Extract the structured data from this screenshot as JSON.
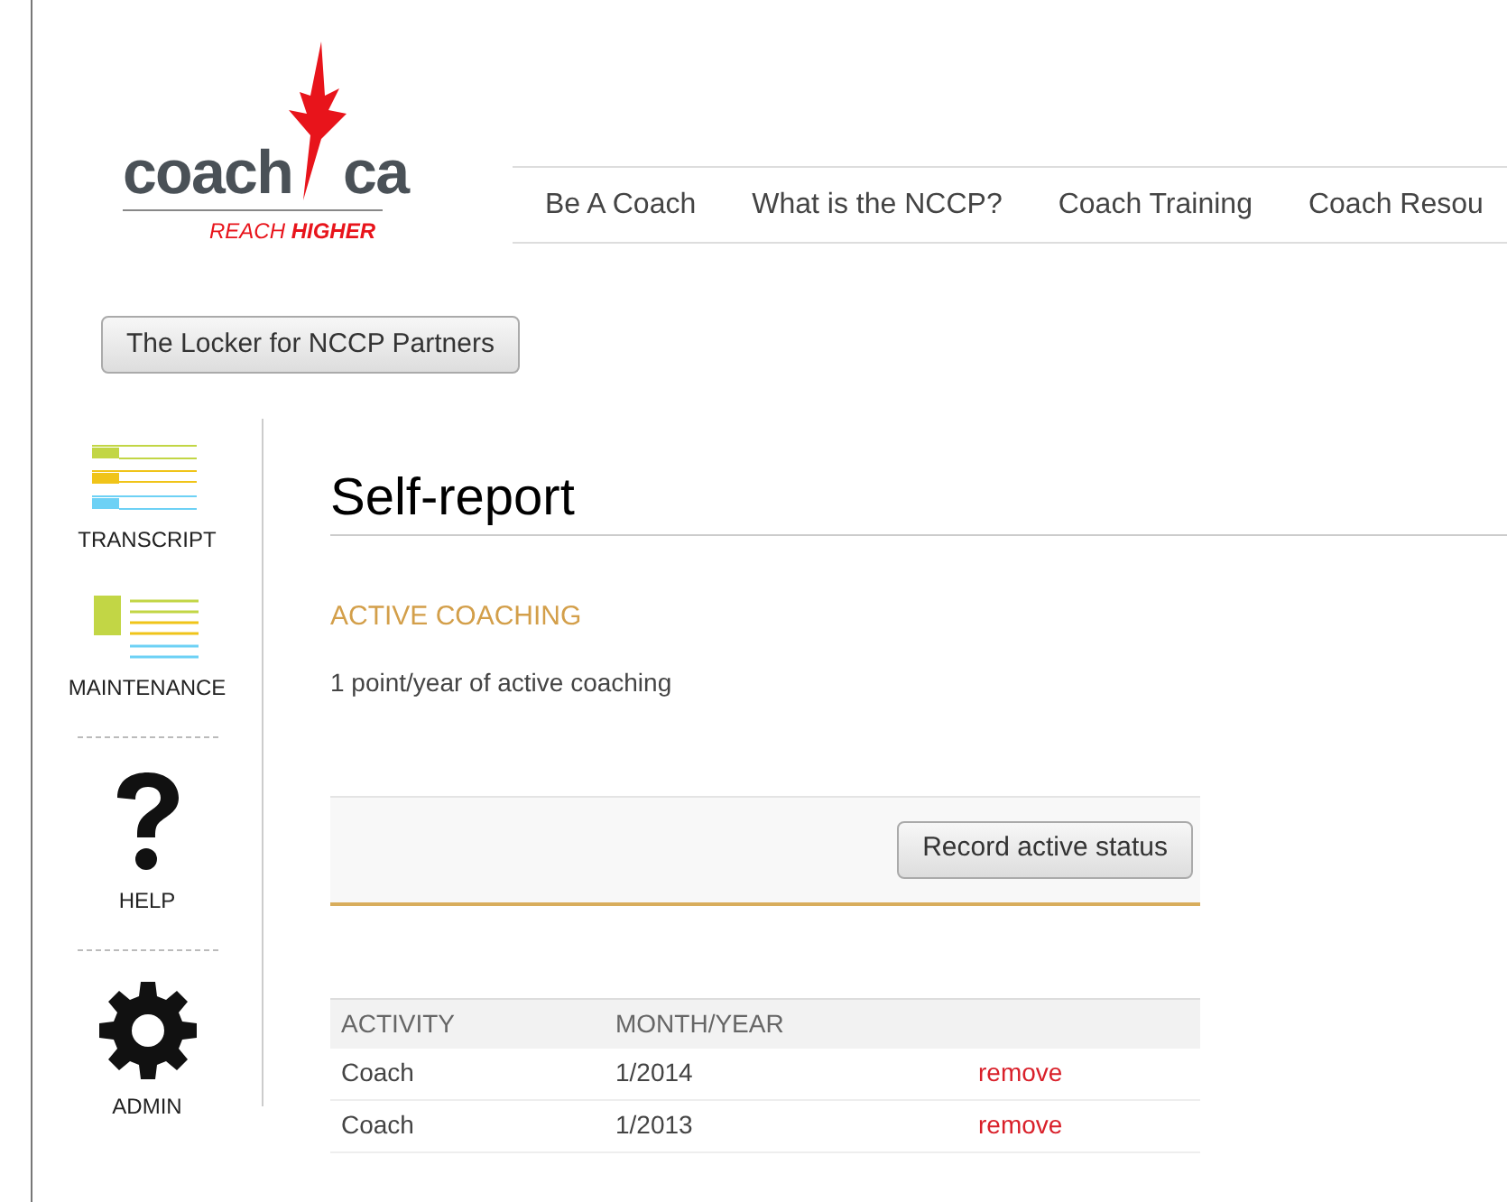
{
  "logo": {
    "name_part_1": "coach",
    "name_part_2": "ca",
    "tagline_part_1": "REACH",
    "tagline_part_2": "HIGHER"
  },
  "nav": [
    "Be A Coach",
    "What is the NCCP?",
    "Coach Training",
    "Coach Resou"
  ],
  "locker_button": "The Locker for NCCP Partners",
  "sidebar": [
    {
      "kind": "transcript",
      "label": "TRANSCRIPT"
    },
    {
      "kind": "maintenance",
      "label": "MAINTENANCE"
    },
    {
      "kind": "help",
      "label": "HELP"
    },
    {
      "kind": "admin",
      "label": "ADMIN"
    }
  ],
  "page_title": "Self-report",
  "section_heading": "ACTIVE COACHING",
  "section_note": "1 point/year of active coaching",
  "record_button": "Record active status",
  "table": {
    "columns": [
      "ACTIVITY",
      "MONTH/YEAR"
    ],
    "rows": [
      {
        "activity": "Coach",
        "month_year": "1/2014",
        "action": "remove"
      },
      {
        "activity": "Coach",
        "month_year": "1/2013",
        "action": "remove"
      }
    ]
  }
}
